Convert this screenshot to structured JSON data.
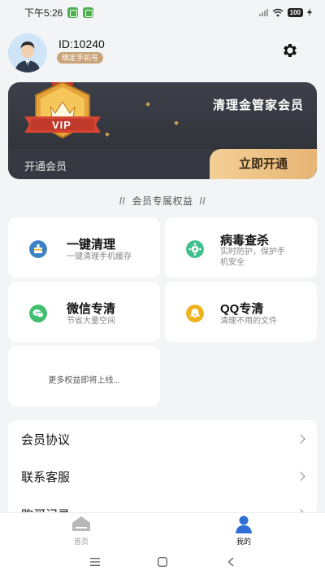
{
  "status_bar": {
    "time": "下午5:26",
    "battery": "100"
  },
  "profile": {
    "user_id": "ID:10240",
    "bind_phone": "绑定手机号"
  },
  "vip": {
    "badge_text": "VIP",
    "title": "清理金管家会员",
    "open_label": "开通会员",
    "open_button": "立即开通"
  },
  "benefits": {
    "header": "会员专属权益",
    "items": [
      {
        "title": "一键清理",
        "desc": "一键清理手机缓存",
        "icon": "broom-icon",
        "color": "#3b82c4"
      },
      {
        "title": "病毒查杀",
        "desc": "实时防护，保护手机安全",
        "icon": "virus-icon",
        "color": "#3fbe8e"
      },
      {
        "title": "微信专清",
        "desc": "节省大量空间",
        "icon": "wechat-icon",
        "color": "#3fbe6e"
      },
      {
        "title": "QQ专清",
        "desc": "清理不用的文件",
        "icon": "qq-icon",
        "color": "#f0b21c"
      }
    ],
    "more": "更多权益即将上线..."
  },
  "menu": {
    "items": [
      {
        "label": "会员协议"
      },
      {
        "label": "联系客服"
      },
      {
        "label": "购买记录"
      }
    ]
  },
  "tabs": [
    {
      "label": "首页",
      "active": false
    },
    {
      "label": "我的",
      "active": true
    }
  ],
  "colors": {
    "accent": "#2f6fd6",
    "gold": "#e9b978",
    "card_dark": "#34363d"
  }
}
